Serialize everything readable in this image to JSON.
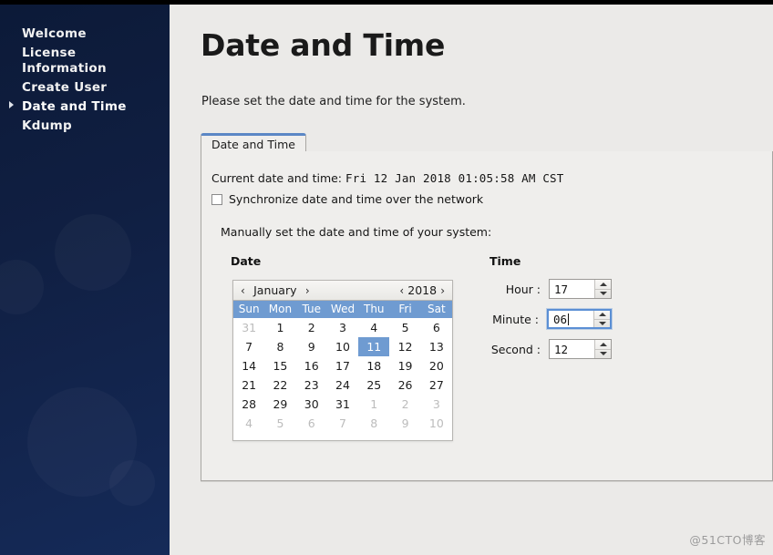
{
  "sidebar": {
    "items": [
      {
        "label": "Welcome",
        "selected": false
      },
      {
        "label": "License Information",
        "selected": false
      },
      {
        "label": "Create User",
        "selected": false
      },
      {
        "label": "Date and Time",
        "selected": true
      },
      {
        "label": "Kdump",
        "selected": false
      }
    ]
  },
  "page": {
    "title": "Date and Time",
    "subtitle": "Please set the date and time for the system."
  },
  "tabs": [
    {
      "label": "Date and Time",
      "active": true
    }
  ],
  "panel": {
    "current_label": "Current date and time:",
    "current_value": "Fri 12 Jan 2018 01:05:58 AM CST",
    "sync_checkbox_label": "Synchronize date and time over the network",
    "sync_checked": false,
    "manual_label": "Manually set the date and time of your system:"
  },
  "date_section": {
    "heading": "Date",
    "prev_month_icon": "chevron-left-icon",
    "next_month_icon": "chevron-right-icon",
    "prev_year_icon": "chevron-left-icon",
    "next_year_icon": "chevron-right-icon",
    "prev_month_glyph": "‹",
    "next_month_glyph": "›",
    "month": "January",
    "year": "2018",
    "day_headers": [
      "Sun",
      "Mon",
      "Tue",
      "Wed",
      "Thu",
      "Fri",
      "Sat"
    ],
    "selected_day": 11,
    "weeks": [
      [
        {
          "d": "31",
          "adj": true
        },
        {
          "d": "1",
          "adj": false
        },
        {
          "d": "2",
          "adj": false
        },
        {
          "d": "3",
          "adj": false
        },
        {
          "d": "4",
          "adj": false
        },
        {
          "d": "5",
          "adj": false
        },
        {
          "d": "6",
          "adj": false
        }
      ],
      [
        {
          "d": "7",
          "adj": false
        },
        {
          "d": "8",
          "adj": false
        },
        {
          "d": "9",
          "adj": false
        },
        {
          "d": "10",
          "adj": false
        },
        {
          "d": "11",
          "adj": false,
          "sel": true
        },
        {
          "d": "12",
          "adj": false
        },
        {
          "d": "13",
          "adj": false
        }
      ],
      [
        {
          "d": "14",
          "adj": false
        },
        {
          "d": "15",
          "adj": false
        },
        {
          "d": "16",
          "adj": false
        },
        {
          "d": "17",
          "adj": false
        },
        {
          "d": "18",
          "adj": false
        },
        {
          "d": "19",
          "adj": false
        },
        {
          "d": "20",
          "adj": false
        }
      ],
      [
        {
          "d": "21",
          "adj": false
        },
        {
          "d": "22",
          "adj": false
        },
        {
          "d": "23",
          "adj": false
        },
        {
          "d": "24",
          "adj": false
        },
        {
          "d": "25",
          "adj": false
        },
        {
          "d": "26",
          "adj": false
        },
        {
          "d": "27",
          "adj": false
        }
      ],
      [
        {
          "d": "28",
          "adj": false
        },
        {
          "d": "29",
          "adj": false
        },
        {
          "d": "30",
          "adj": false
        },
        {
          "d": "31",
          "adj": false
        },
        {
          "d": "1",
          "adj": true
        },
        {
          "d": "2",
          "adj": true
        },
        {
          "d": "3",
          "adj": true
        }
      ],
      [
        {
          "d": "4",
          "adj": true
        },
        {
          "d": "5",
          "adj": true
        },
        {
          "d": "6",
          "adj": true
        },
        {
          "d": "7",
          "adj": true
        },
        {
          "d": "8",
          "adj": true
        },
        {
          "d": "9",
          "adj": true
        },
        {
          "d": "10",
          "adj": true
        }
      ]
    ]
  },
  "time_section": {
    "heading": "Time",
    "fields": [
      {
        "label": "Hour :",
        "value": "17",
        "focused": false
      },
      {
        "label": "Minute :",
        "value": "06",
        "focused": true
      },
      {
        "label": "Second :",
        "value": "12",
        "focused": false
      }
    ]
  },
  "watermark": "@51CTO博客",
  "colors": {
    "sidebar_top": "#0c1a38",
    "sidebar_bottom": "#152a58",
    "content_bg": "#ebeae8",
    "panel_bg": "#efeeec",
    "accent_blue": "#6f9bd1",
    "tab_accent": "#5b87c5",
    "focus_blue": "#5b8fd4"
  }
}
